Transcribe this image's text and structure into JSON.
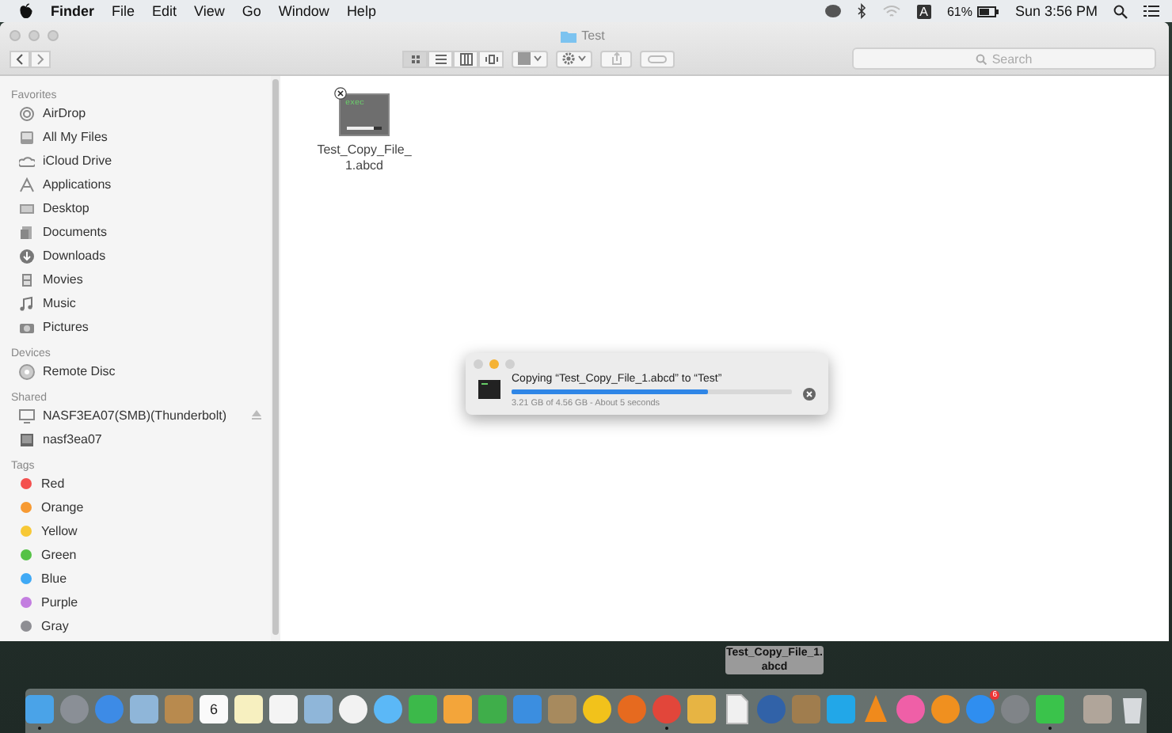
{
  "menubar": {
    "app": "Finder",
    "menus": [
      "File",
      "Edit",
      "View",
      "Go",
      "Window",
      "Help"
    ],
    "input_source": "A",
    "battery": "61%",
    "clock": "Sun 3:56 PM"
  },
  "window": {
    "title": "Test"
  },
  "toolbar": {
    "view_modes": [
      {
        "selected": true
      },
      {
        "selected": false
      },
      {
        "selected": false
      },
      {
        "selected": false
      }
    ],
    "search": {
      "placeholder": "Search"
    }
  },
  "sidebar": {
    "sections": [
      {
        "heading": "Favorites",
        "items": [
          {
            "label": "AirDrop"
          },
          {
            "label": "All My Files"
          },
          {
            "label": "iCloud Drive"
          },
          {
            "label": "Applications"
          },
          {
            "label": "Desktop"
          },
          {
            "label": "Documents"
          },
          {
            "label": "Downloads"
          },
          {
            "label": "Movies"
          },
          {
            "label": "Music"
          },
          {
            "label": "Pictures"
          }
        ]
      },
      {
        "heading": "Devices",
        "items": [
          {
            "label": "Remote Disc"
          }
        ]
      },
      {
        "heading": "Shared",
        "items": [
          {
            "label": "NASF3EA07(SMB)(Thunderbolt)",
            "ejectable": true
          },
          {
            "label": "nasf3ea07",
            "ejectable": false
          }
        ]
      },
      {
        "heading": "Tags",
        "items": [
          {
            "label": "Red",
            "color": "#f4504e"
          },
          {
            "label": "Orange",
            "color": "#f79a32"
          },
          {
            "label": "Yellow",
            "color": "#f7c836"
          },
          {
            "label": "Green",
            "color": "#55c246"
          },
          {
            "label": "Blue",
            "color": "#3fa9f5"
          },
          {
            "label": "Purple",
            "color": "#c37ee0"
          },
          {
            "label": "Gray",
            "color": "#8e8e93"
          }
        ]
      }
    ]
  },
  "files": [
    {
      "name": "Test_Copy_File_1.abcd",
      "thumbnail_text": "exec",
      "level": 0.75
    }
  ],
  "copy_dialog": {
    "title": "Copying “Test_Copy_File_1.abcd” to “Test”",
    "level": 0.7,
    "status": "3.21 GB of 4.56 GB - About 5 seconds"
  },
  "drag_label": "Test_Copy_File_1.abcd",
  "dock": {
    "items": [
      {
        "kind": "finder",
        "running": true
      },
      {
        "kind": "launchpad",
        "running": false
      },
      {
        "kind": "safari",
        "running": false
      },
      {
        "kind": "preview",
        "running": false
      },
      {
        "kind": "contacts",
        "running": false
      },
      {
        "kind": "calendar",
        "running": false,
        "date": "6"
      },
      {
        "kind": "notes",
        "running": false
      },
      {
        "kind": "reminders",
        "running": false
      },
      {
        "kind": "preview",
        "running": false
      },
      {
        "kind": "photos",
        "running": false
      },
      {
        "kind": "messages",
        "running": false
      },
      {
        "kind": "facetime",
        "running": false
      },
      {
        "kind": "pages",
        "running": false
      },
      {
        "kind": "numbers",
        "running": false
      },
      {
        "kind": "keynote",
        "running": false
      },
      {
        "kind": "archive",
        "running": false
      },
      {
        "kind": "radiation",
        "running": false
      },
      {
        "kind": "firefox",
        "running": false
      },
      {
        "kind": "chrome",
        "running": true
      },
      {
        "kind": "cocktail",
        "running": false
      },
      {
        "kind": "document",
        "running": false
      },
      {
        "kind": "quicktime",
        "running": false
      },
      {
        "kind": "map",
        "running": false
      },
      {
        "kind": "skype",
        "running": false
      },
      {
        "kind": "vlc",
        "running": false
      },
      {
        "kind": "itunes",
        "running": false
      },
      {
        "kind": "ibooks",
        "running": false
      },
      {
        "kind": "appstore",
        "running": false,
        "badge": "6"
      },
      {
        "kind": "settings",
        "running": false
      },
      {
        "kind": "line",
        "running": true
      },
      {
        "kind": "stack",
        "running": false
      },
      {
        "kind": "trash",
        "running": false
      }
    ]
  }
}
